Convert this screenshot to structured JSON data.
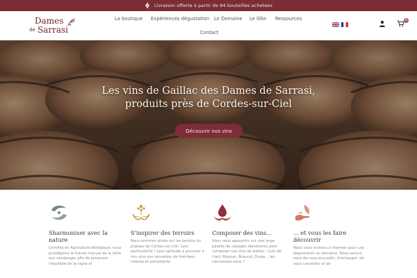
{
  "promo": {
    "text": "Livraison offerte à partir de 84 bouteilles achetées",
    "icon": "grape-icon"
  },
  "header": {
    "logo": {
      "line1": "Dames",
      "line2_small": "de",
      "line2": "Sarrasi"
    },
    "nav": [
      {
        "label": "La boutique"
      },
      {
        "label": "Expériences dégustation"
      },
      {
        "label": "Le Domaine"
      },
      {
        "label": "Le Gîte"
      },
      {
        "label": "Ressources"
      },
      {
        "label": "Contact"
      }
    ],
    "languages": [
      "en",
      "fr"
    ],
    "cart_count": "0"
  },
  "hero": {
    "title_line1": "Les vins de Gaillac des Dames de Sarrasi,",
    "title_line2": "produits près de Cordes-sur-Ciel",
    "button_label": "Découvrir nos vins"
  },
  "features": [
    {
      "icon": "harmony-hands-icon",
      "title": "Sharmoniser avec la nature",
      "body": "Certifiés en Agriculture Biologique, nous privilégions le travail manuel de la taille aux vendanges afin de préserver l'équilibre de la vigne et"
    },
    {
      "icon": "hands-vine-icon",
      "title": "S'inspirer des terroirs",
      "body": "Nous sommes situés sur les terroirs du plateau de Cordes-sur-Ciel. Leur particularité ? Leur aptitude à procurer à nos vins une sensation de fraîcheur intense et persistante"
    },
    {
      "icon": "wine-drop-icon",
      "title": "Composer des vins...",
      "body": "Nous nous appuyons sur une large palette de cépages identitaires pour composer nos vins de Gaillac : Loin de l'oeil, Mauzac, Braucol, Duras... les connaissez-vous ?"
    },
    {
      "icon": "hand-leaf-icon",
      "title": "... et vous les faire découvrir",
      "body": "Nous vous invitons à réserver pour une dégustation au domaine. Nous serons ravis de vous accueillir, d'échanger, de vous conseiller et de"
    }
  ],
  "colors": {
    "brand": "#7b2c35",
    "icon_green": "#6c8c7a",
    "icon_gold": "#c79a4b",
    "icon_wine": "#8e2f3b",
    "icon_coral": "#d07a62"
  }
}
